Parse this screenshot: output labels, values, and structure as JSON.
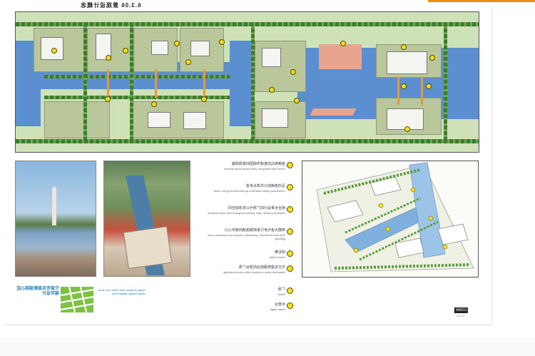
{
  "title": "6.3.06 景观设计概念",
  "legend": [
    {
      "title": "连接南北向各城市组团的景观绿轴",
      "sub": "Green axis linking the north-south urban clusters"
    },
    {
      "title": "沿河连续的公共滨水步道",
      "sub": "Continuous public waterfront promenade along the canal"
    },
    {
      "title": "结合水景设计的广场与公共活动空间",
      "sub": "Plazas and public open spaces integrated with water features"
    },
    {
      "title": "林荫大道与步行系统相连通的城市入口",
      "sub": "Tree-lined boulevard, pedestrian network and landmark urban gateway"
    },
    {
      "title": "绿化带",
      "sub": "Green buffer"
    },
    {
      "title": "与文化建筑相结合的滨水广场",
      "sub": "Waterfront plaza combined with cultural buildings"
    },
    {
      "title": "广场",
      "sub": "Plaza"
    },
    {
      "title": "水景台",
      "sub": "Water stage"
    }
  ],
  "project": {
    "name_cn": "宁波市东部新城核心区城市设计",
    "name_en": "Ningbo Eastern New Town Core Area Urban Design Master Plan"
  },
  "tag": "EDAW",
  "tag_sub": "AECOM",
  "colors": {
    "water": "#5b8fcf",
    "accent": "#f08a1c",
    "logo": "#7cc142",
    "brand_text": "#1a7fb5"
  }
}
